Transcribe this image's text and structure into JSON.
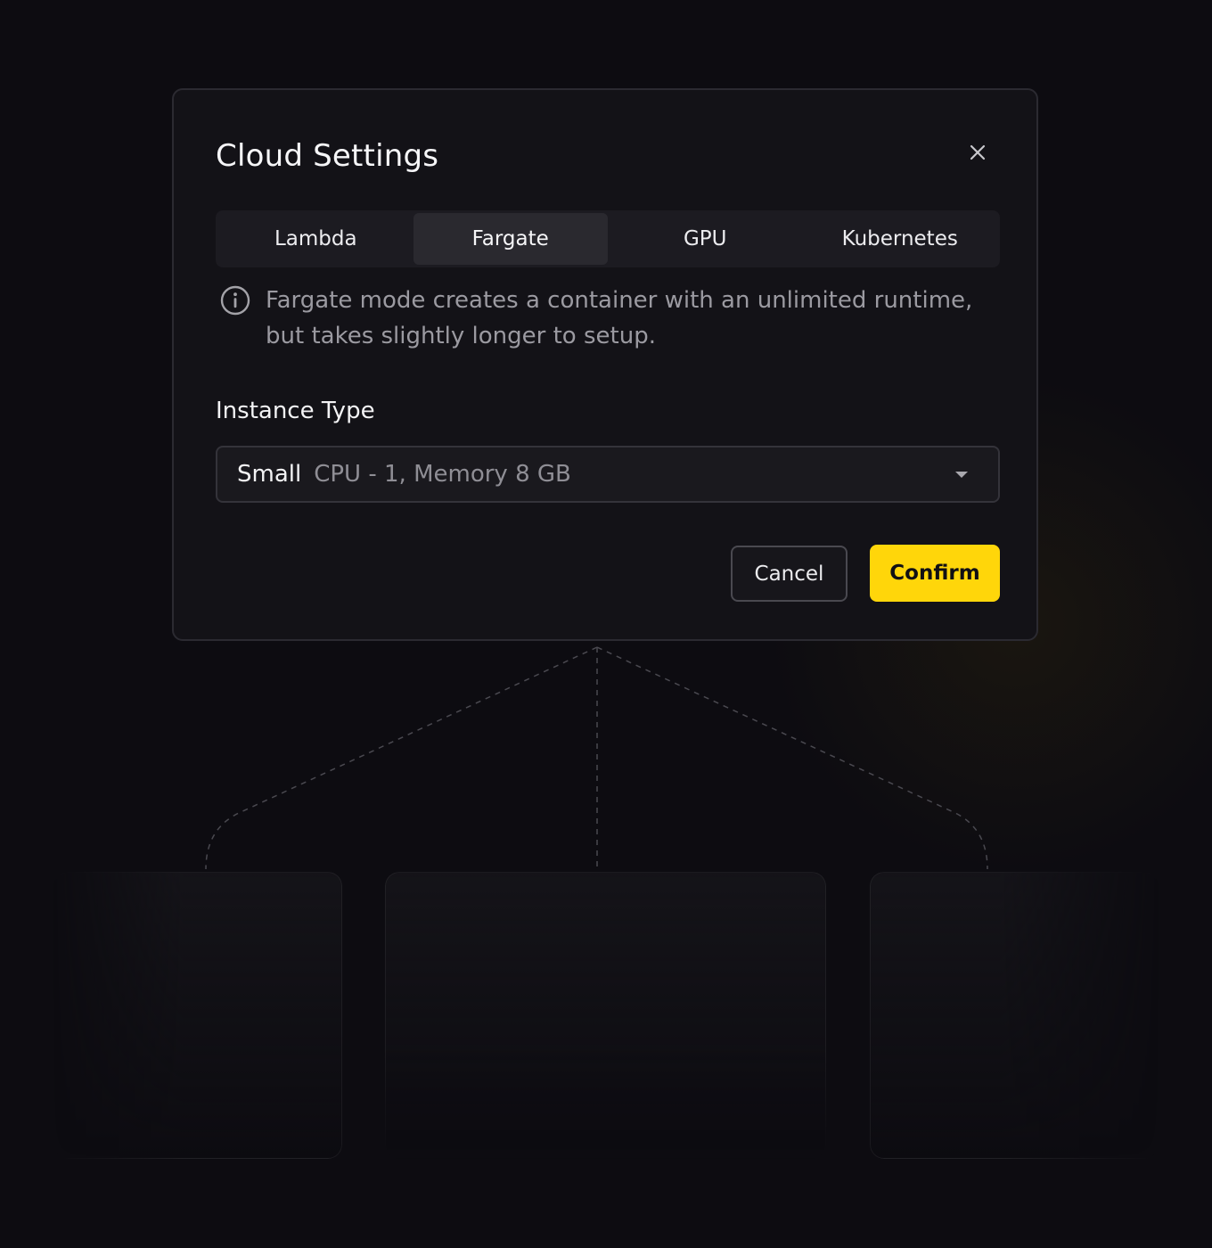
{
  "colors": {
    "background": "#0d0c11",
    "modal": "#131217",
    "accent": "#ffd60a",
    "muted_text": "#9b9aa1"
  },
  "modal": {
    "title": "Cloud Settings",
    "close_icon": "close-icon",
    "tabs": [
      {
        "label": "Lambda",
        "active": false
      },
      {
        "label": "Fargate",
        "active": true
      },
      {
        "label": "GPU",
        "active": false
      },
      {
        "label": "Kubernetes",
        "active": false
      }
    ],
    "info": {
      "icon": "info-icon",
      "text": "Fargate mode creates a container with an unlimited runtime, but takes slightly longer to setup."
    },
    "instance_type": {
      "label": "Instance Type",
      "selected_name": "Small",
      "selected_detail": "CPU - 1, Memory 8 GB",
      "caret_icon": "caret-down-icon"
    },
    "actions": {
      "cancel_label": "Cancel",
      "confirm_label": "Confirm"
    }
  }
}
